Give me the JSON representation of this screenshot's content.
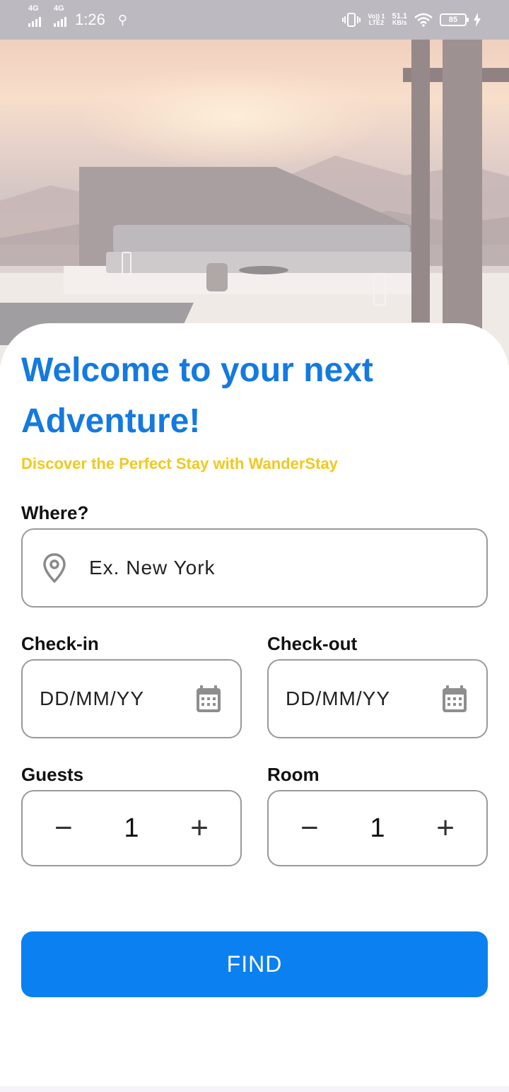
{
  "status_bar": {
    "net1": "4G",
    "net2": "4G",
    "time": "1:26",
    "volte_line1": "Vo)) 1",
    "volte_line2": "LTE2",
    "speed_value": "51.1",
    "speed_unit": "KB/s",
    "battery": "85"
  },
  "hero": {
    "image": "desert-villa-lounge-photo"
  },
  "header": {
    "title": "Welcome to your next Adventure!",
    "subtitle": "Discover the Perfect Stay with WanderStay"
  },
  "form": {
    "where": {
      "label": "Where?",
      "placeholder": "Ex. New York",
      "icon": "location-pin-icon"
    },
    "checkin": {
      "label": "Check-in",
      "placeholder": "DD/MM/YY",
      "icon": "calendar-icon"
    },
    "checkout": {
      "label": "Check-out",
      "placeholder": "DD/MM/YY",
      "icon": "calendar-icon"
    },
    "guests": {
      "label": "Guests",
      "value": "1",
      "minus": "−",
      "plus": "+"
    },
    "room": {
      "label": "Room",
      "value": "1",
      "minus": "−",
      "plus": "+"
    }
  },
  "find_button": {
    "label": "FIND"
  },
  "colors": {
    "primary": "#0b80f0",
    "title": "#1479e0",
    "subtitle": "#f2c81e",
    "status_bar": "#bcb9c0",
    "field_border": "#9a9a9a"
  }
}
